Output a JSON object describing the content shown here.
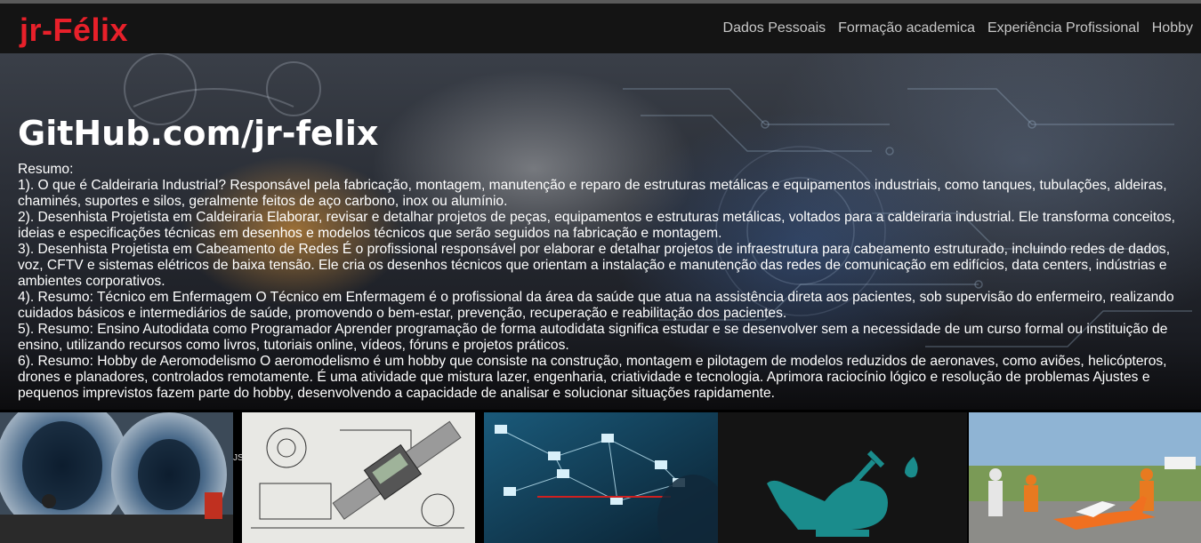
{
  "brand": "jr-Félix",
  "nav": [
    "Dados Pessoais",
    "Formação academica",
    "Experiência Profissional",
    "Hobby"
  ],
  "hero": {
    "title": "GitHub.com/jr-felix",
    "lines": [
      "Resumo:",
      "1). O que é Caldeiraria Industrial? Responsável pela fabricação, montagem, manutenção e reparo de estruturas metálicas e equipamentos industriais, como tanques, tubulações, aldeiras, chaminés, suportes e silos, geralmente feitos de aço carbono, inox ou alumínio.",
      "2). Desenhista Projetista em Caldeiraria Elaborar, revisar e detalhar projetos de peças, equipamentos e estruturas metálicas, voltados para a caldeiraria industrial. Ele transforma conceitos, ideias e especificações técnicas em desenhos e modelos técnicos que serão seguidos na fabricação e montagem.",
      "3). Desenhista Projetista em Cabeamento de Redes É o profissional responsável por elaborar e detalhar projetos de infraestrutura para cabeamento estruturado, incluindo redes de dados, voz, CFTV e sistemas elétricos de baixa tensão. Ele cria os desenhos técnicos que orientam a instalação e manutenção das redes de comunicação em edifícios, data centers, indústrias e ambientes corporativos.",
      "4). Resumo: Técnico em Enfermagem O Técnico em Enfermagem é o profissional da área da saúde que atua na assistência direta aos pacientes, sob supervisão do enfermeiro, realizando cuidados básicos e intermediários de saúde, promovendo o bem-estar, prevenção, recuperação e reabilitação dos pacientes.",
      "5). Resumo: Ensino Autodidata como Programador Aprender programação de forma autodidata significa estudar e se desenvolver sem a necessidade de um curso formal ou instituição de ensino, utilizando recursos como livros, tutoriais online, vídeos, fóruns e projetos práticos.",
      "6). Resumo: Hobby de Aeromodelismo O aeromodelismo é um hobby que consiste na construção, montagem e pilotagem de modelos reduzidos de aeronaves, como aviões, helicópteros, drones e planadores, controlados remotamente. É uma atividade que mistura lazer, engenharia, criatividade e tecnologia. Aprimora raciocínio lógico e resolução de problemas Ajustes e pequenos imprevistos fazem parte do hobby, desenvolvendo a capacidade de analisar e solucionar situações rapidamente."
    ]
  },
  "gallery_text": "JS",
  "colors": {
    "brand": "#e8202a",
    "navbar": "#141414",
    "nav_link": "#c8c8c8",
    "nursing_icon": "#1a8c8c"
  }
}
